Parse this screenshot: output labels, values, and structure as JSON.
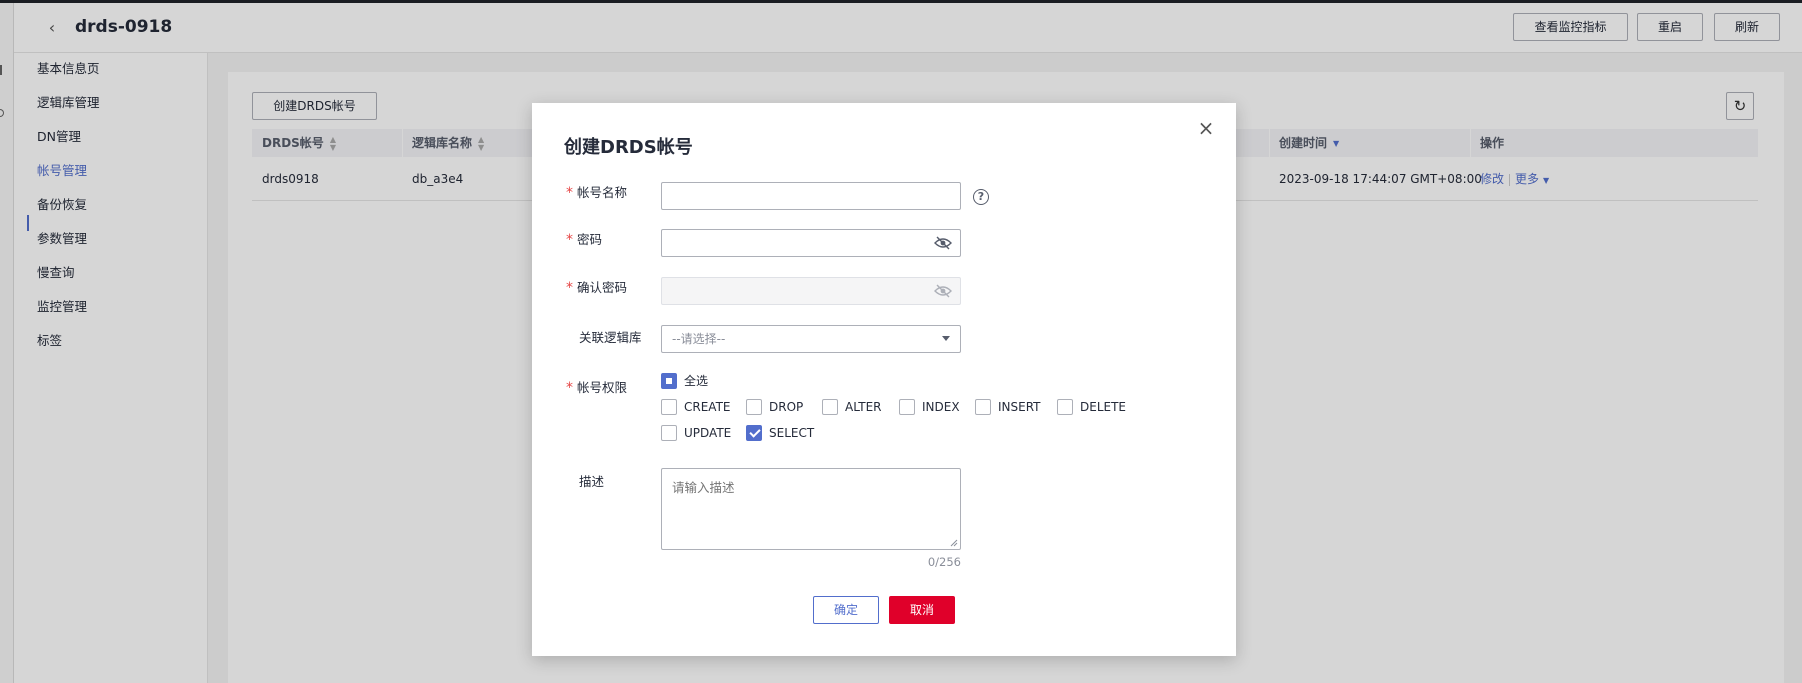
{
  "header": {
    "title": "drds-0918",
    "buttons": {
      "monitor": "查看监控指标",
      "restart": "重启",
      "refresh": "刷新"
    }
  },
  "sidebar": {
    "items": [
      "基本信息页",
      "逻辑库管理",
      "DN管理",
      "帐号管理",
      "备份恢复",
      "参数管理",
      "慢查询",
      "监控管理",
      "标签"
    ],
    "active_index": 3
  },
  "main": {
    "create_button": "创建DRDS帐号",
    "table": {
      "columns": [
        "DRDS帐号",
        "逻辑库名称",
        "创建时间",
        "操作"
      ],
      "rows": [
        {
          "account": "drds0918",
          "database": "db_a3e4",
          "created": "2023-09-18 17:44:07 GMT+08:00",
          "edit": "修改",
          "more": "更多"
        }
      ]
    }
  },
  "dialog": {
    "title": "创建DRDS帐号",
    "fields": {
      "account_name": {
        "label": "帐号名称",
        "value": ""
      },
      "password": {
        "label": "密码",
        "value": ""
      },
      "confirm_password": {
        "label": "确认密码",
        "value": ""
      },
      "logical_db": {
        "label": "关联逻辑库",
        "placeholder": "--请选择--"
      },
      "permissions": {
        "label": "帐号权限",
        "select_all": "全选",
        "options": [
          {
            "name": "CREATE",
            "checked": false
          },
          {
            "name": "DROP",
            "checked": false
          },
          {
            "name": "ALTER",
            "checked": false
          },
          {
            "name": "INDEX",
            "checked": false
          },
          {
            "name": "INSERT",
            "checked": false
          },
          {
            "name": "DELETE",
            "checked": false
          },
          {
            "name": "UPDATE",
            "checked": false
          },
          {
            "name": "SELECT",
            "checked": true
          }
        ]
      },
      "description": {
        "label": "描述",
        "placeholder": "请输入描述",
        "counter": "0/256"
      }
    },
    "ok_label": "确定",
    "cancel_label": "取消"
  },
  "colors": {
    "accent": "#526ecc",
    "danger": "#e0002a",
    "required": "#e54545"
  }
}
